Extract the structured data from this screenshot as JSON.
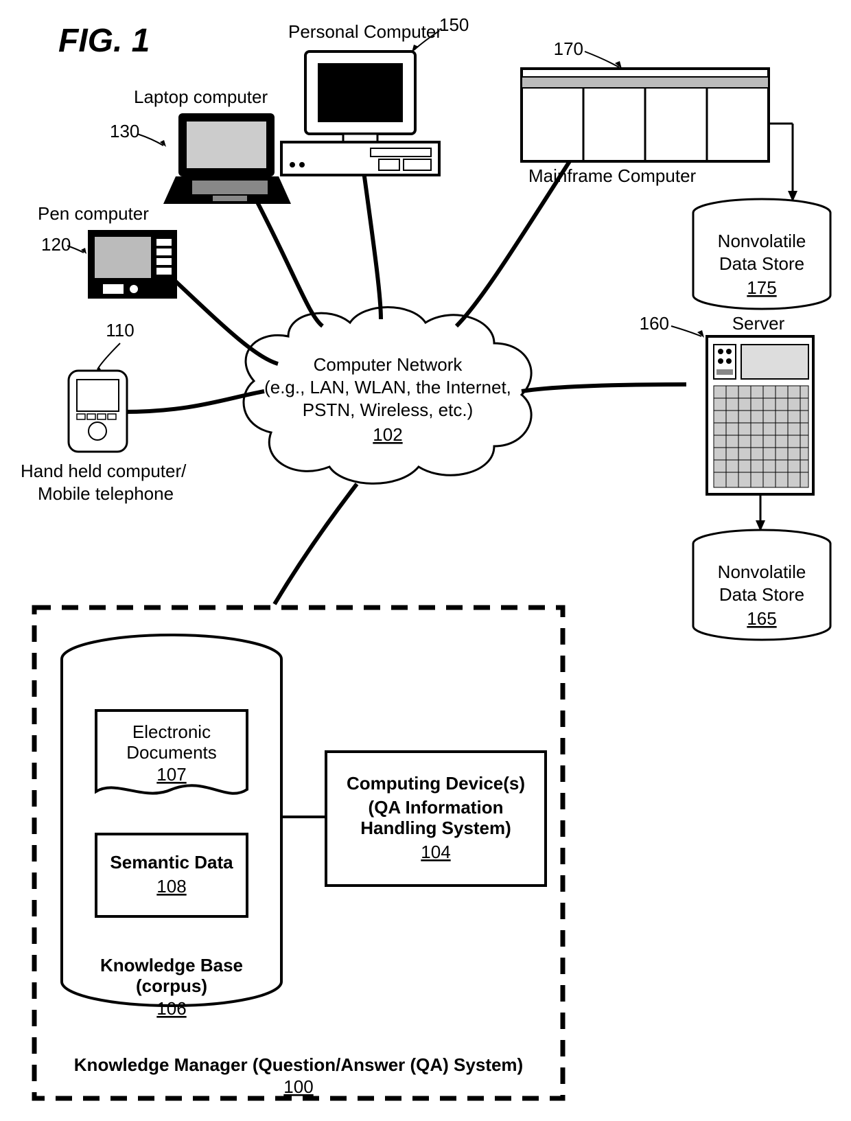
{
  "figure_label": "FIG. 1",
  "cloud": {
    "line1": "Computer Network",
    "line2": "(e.g., LAN, WLAN, the Internet,",
    "line3": "PSTN, Wireless, etc.)",
    "ref": "102"
  },
  "nodes": {
    "handheld": {
      "label_l1": "Hand held computer/",
      "label_l2": "Mobile telephone",
      "ref": "110"
    },
    "pen": {
      "label": "Pen computer",
      "ref": "120"
    },
    "laptop": {
      "label": "Laptop computer",
      "ref": "130"
    },
    "pc": {
      "label": "Personal Computer",
      "ref": "150"
    },
    "mainframe": {
      "label": "Mainframe Computer",
      "ref": "170"
    },
    "server": {
      "label": "Server",
      "ref": "160"
    },
    "ds_upper": {
      "l1": "Nonvolatile",
      "l2": "Data Store",
      "ref": "175"
    },
    "ds_lower": {
      "l1": "Nonvolatile",
      "l2": "Data Store",
      "ref": "165"
    }
  },
  "km": {
    "title": "Knowledge Manager (Question/Answer (QA) System)",
    "ref": "100",
    "kb": {
      "title_l1": "Knowledge Base",
      "title_l2": "(corpus)",
      "ref": "106"
    },
    "edocs": {
      "l1": "Electronic",
      "l2": "Documents",
      "ref": "107"
    },
    "semantic": {
      "l1": "Semantic Data",
      "ref": "108"
    },
    "cd": {
      "l1": "Computing Device(s)",
      "l2": "(QA Information",
      "l3": "Handling System)",
      "ref": "104"
    }
  }
}
